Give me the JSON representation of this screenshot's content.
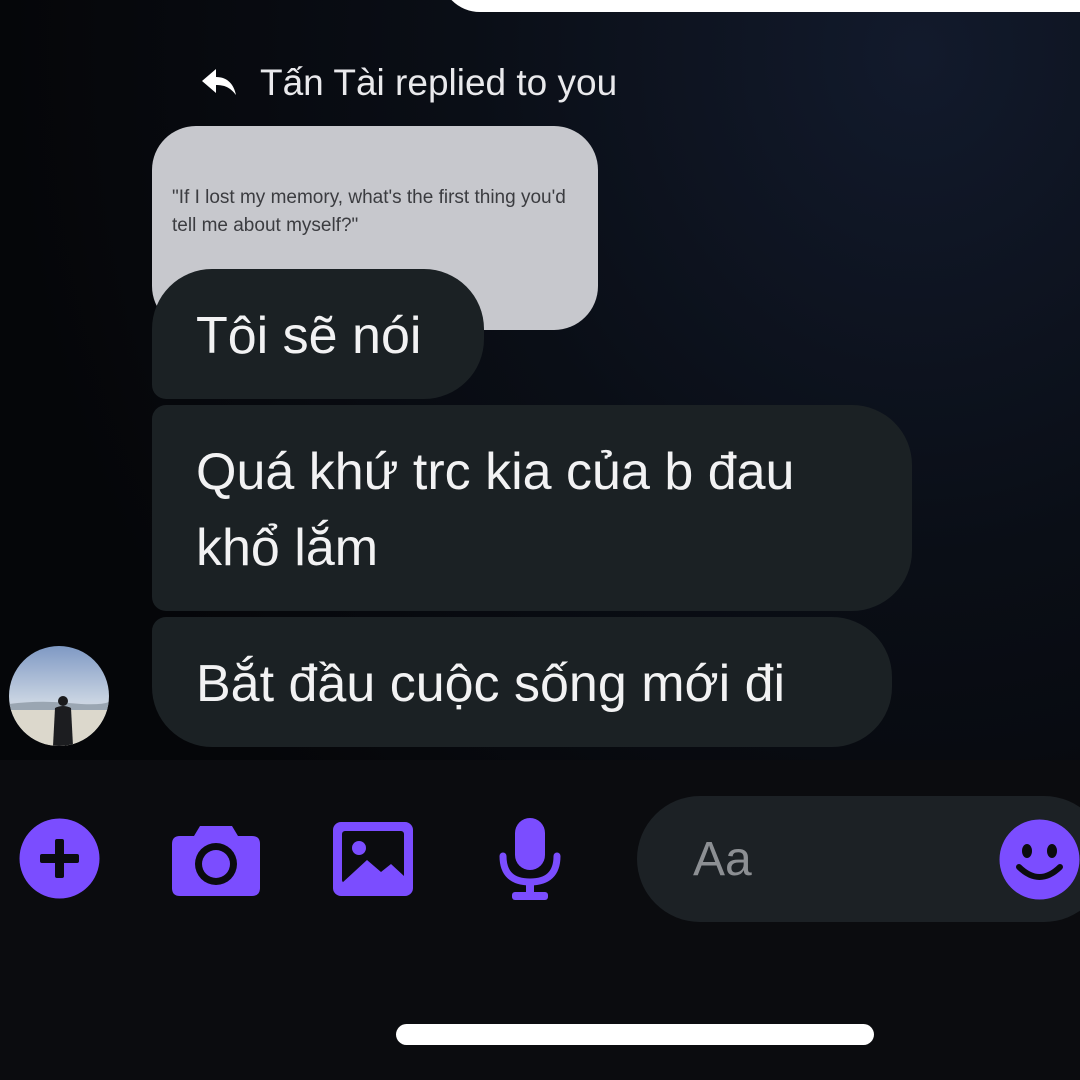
{
  "reply_header": {
    "text": "Tấn Tài replied to you",
    "icon": "reply-arrow-icon"
  },
  "quoted_message": {
    "text": "\"If I lost my memory, what's the first thing you'd tell me about myself?\""
  },
  "messages": [
    {
      "text": "Tôi sẽ nói"
    },
    {
      "text": "Quá khứ trc kia của b đau khổ lắm"
    },
    {
      "text": "Bắt đầu cuộc sống mới đi"
    }
  ],
  "composer": {
    "input_placeholder": "Aa",
    "icons": [
      "plus-icon",
      "camera-icon",
      "image-icon",
      "microphone-icon",
      "emoji-icon"
    ]
  },
  "colors": {
    "accent": "#7b4dff",
    "bubble_received": "#1b2124",
    "quoted_bubble": "#c7c8cd",
    "background": "#050609"
  }
}
